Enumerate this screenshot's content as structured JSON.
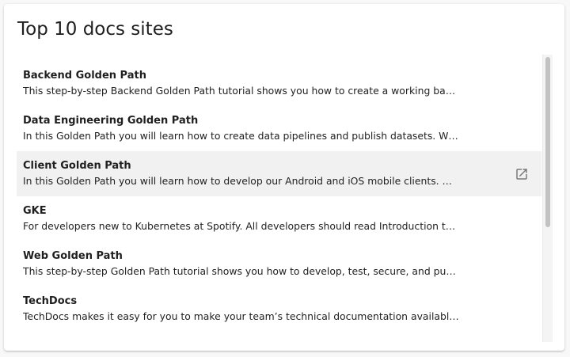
{
  "card": {
    "title": "Top 10 docs sites"
  },
  "items": [
    {
      "title": "Backend Golden Path",
      "description": "This step-by-step Backend Golden Path tutorial shows you how to create a working ba…"
    },
    {
      "title": "Data Engineering Golden Path",
      "description": "In this Golden Path you will learn how to create data pipelines and publish datasets. W…"
    },
    {
      "title": "Client Golden Path",
      "description": "In this Golden Path you will learn how to develop our Android and iOS mobile clients. …",
      "hovered": true,
      "action_icon": "open-in-new-icon"
    },
    {
      "title": "GKE",
      "description": "For developers new to Kubernetes at Spotify. All developers should read Introduction t…"
    },
    {
      "title": "Web Golden Path",
      "description": "This step-by-step Golden Path tutorial shows you how to develop, test, secure, and pu…"
    },
    {
      "title": "TechDocs",
      "description": "TechDocs makes it easy for you to make your team’s technical documentation availabl…"
    }
  ],
  "colors": {
    "hover_background": "#f1f1f1",
    "scroll_thumb": "#c2c2c2",
    "icon": "#7a7a7a"
  }
}
